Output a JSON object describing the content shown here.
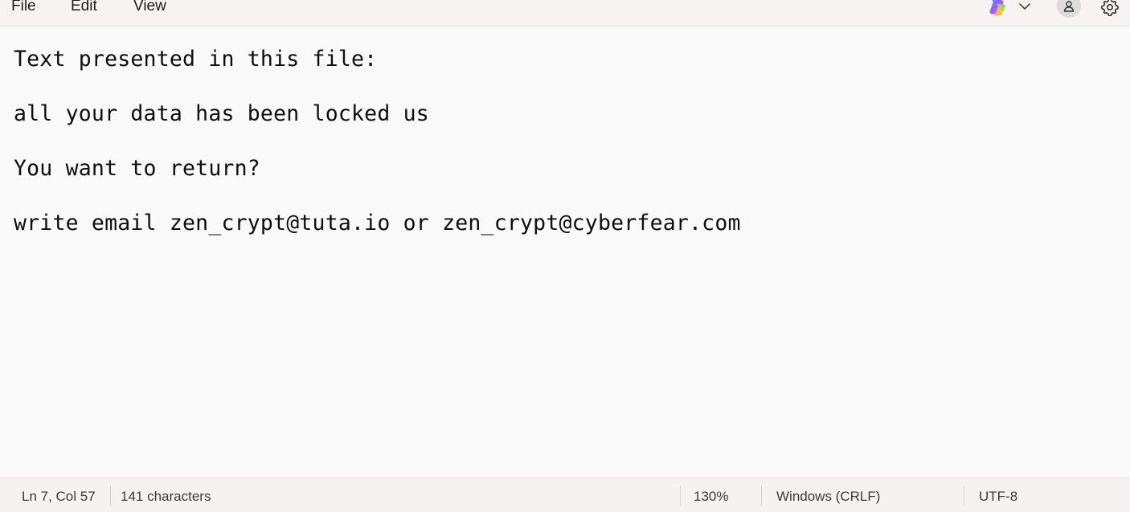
{
  "menubar": {
    "items": [
      "File",
      "Edit",
      "View"
    ]
  },
  "toolbar": {
    "icons": [
      "copilot-icon",
      "chevron-down-icon",
      "account-icon",
      "gear-icon"
    ]
  },
  "document": {
    "lines": [
      "Text presented in this file:",
      "all your data has been locked us",
      "You want to return?",
      "write email zen_crypt@tuta.io or zen_crypt@cyberfear.com"
    ]
  },
  "status": {
    "position": "Ln 7, Col 57",
    "characters": "141 characters",
    "zoom": "130%",
    "line_ending": "Windows (CRLF)",
    "encoding": "UTF-8"
  }
}
